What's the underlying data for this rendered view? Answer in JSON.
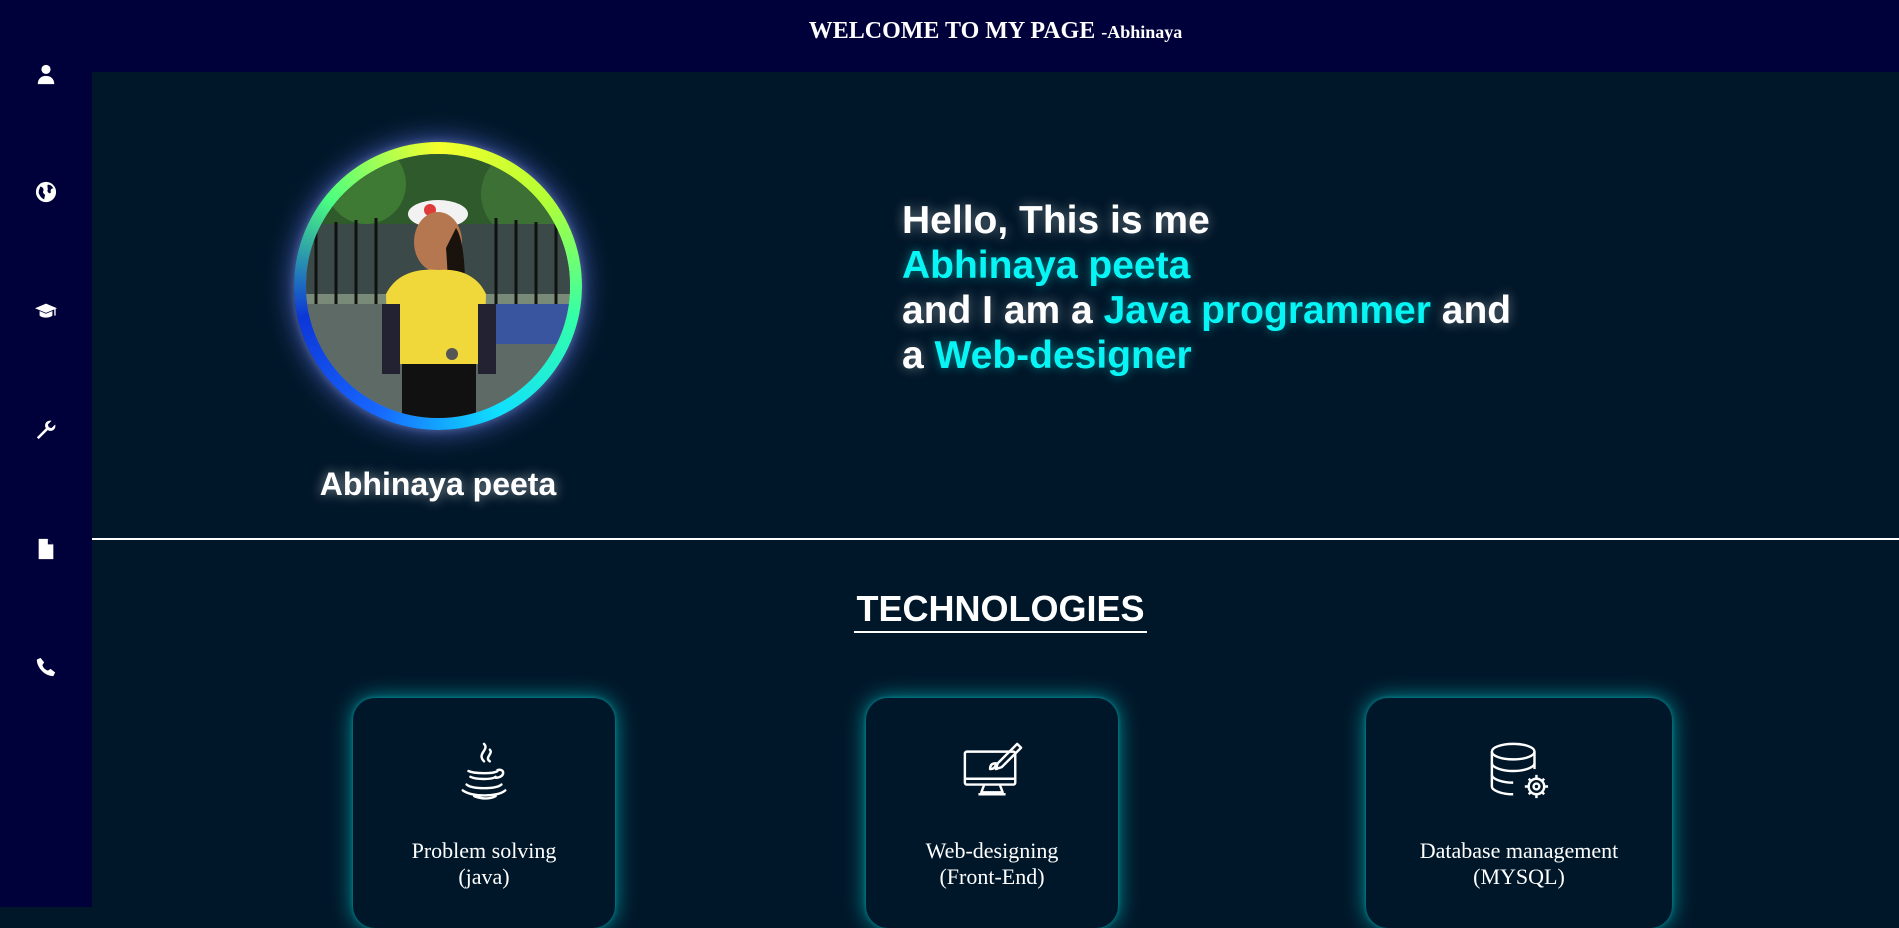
{
  "sidebar": {
    "items": [
      {
        "icon": "user-icon"
      },
      {
        "icon": "globe-icon"
      },
      {
        "icon": "graduation-cap-icon"
      },
      {
        "icon": "wrench-icon"
      },
      {
        "icon": "file-icon"
      },
      {
        "icon": "phone-icon"
      }
    ]
  },
  "header": {
    "title": "WELCOME TO MY PAGE",
    "subtitle": "-Abhinaya"
  },
  "hero": {
    "name": "Abhinaya peeta",
    "greeting": "Hello, This is me",
    "highlight_name": "Abhinaya peeta",
    "and_i_am_a": "and I am a",
    "role1": "Java programmer",
    "and": "and",
    "a": "a",
    "role2": "Web-designer"
  },
  "technologies": {
    "title": "TECHNOLOGIES",
    "cards": [
      {
        "icon": "java-icon",
        "line1": "Problem solving",
        "line2": "(java)"
      },
      {
        "icon": "web-design-icon",
        "line1": "Web-designing",
        "line2": "(Front-End)"
      },
      {
        "icon": "database-icon",
        "line1": "Database management",
        "line2": "(MYSQL)"
      }
    ]
  },
  "colors": {
    "accent": "#08f5f5",
    "sidebar": "#00003a",
    "background": "#001729"
  }
}
